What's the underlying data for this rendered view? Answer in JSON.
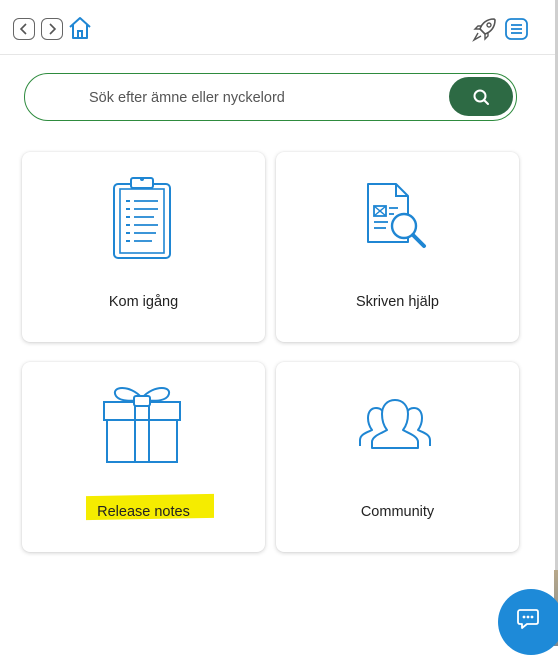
{
  "search": {
    "placeholder": "Sök efter ämne eller nyckelord"
  },
  "cards": [
    {
      "label": "Kom igång",
      "icon": "clipboard-icon"
    },
    {
      "label": "Skriven hjälp",
      "icon": "document-search-icon"
    },
    {
      "label": "Release notes",
      "icon": "gift-icon"
    },
    {
      "label": "Community",
      "icon": "people-group-icon"
    }
  ],
  "toolbar": {
    "icons": [
      "back-icon",
      "forward-icon",
      "home-icon",
      "rocket-icon",
      "menu-icon"
    ]
  },
  "colors": {
    "accent": "#2d6a44",
    "brand_blue": "#1f86d3",
    "highlight": "#f5ec00",
    "chat_button": "#1e8ad8"
  }
}
